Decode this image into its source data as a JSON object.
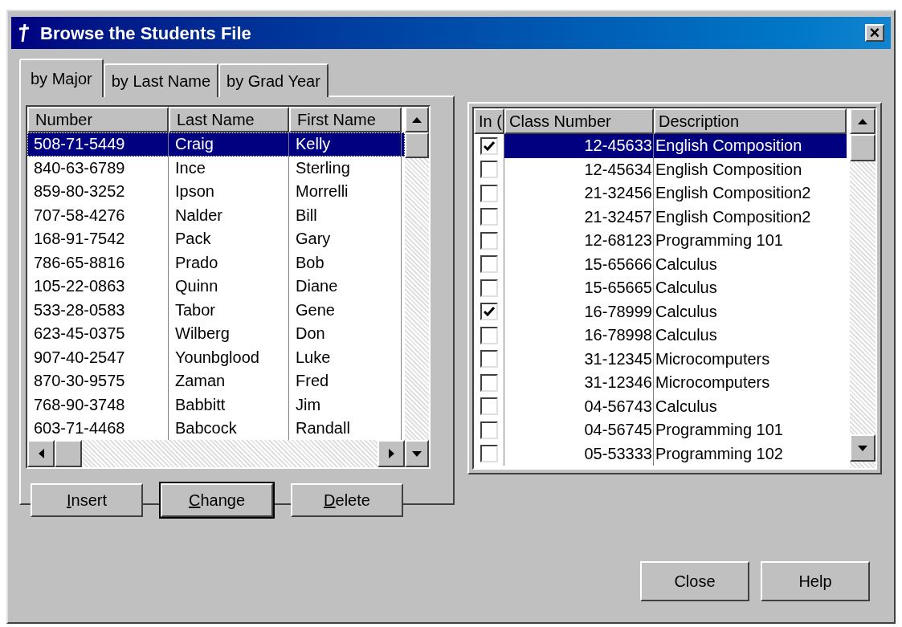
{
  "window": {
    "title": "Browse the Students File",
    "close": "×"
  },
  "tabs": [
    {
      "label": "by Major",
      "selected": true
    },
    {
      "label": "by Last Name",
      "selected": false
    },
    {
      "label": "by Grad Year",
      "selected": false
    }
  ],
  "students": {
    "columns": [
      "Number",
      "Last Name",
      "First Name"
    ],
    "rows": [
      {
        "cells": [
          "508-71-5449",
          "Craig",
          "Kelly"
        ],
        "selected": true
      },
      {
        "cells": [
          "840-63-6789",
          "Ince",
          "Sterling"
        ],
        "selected": false
      },
      {
        "cells": [
          "859-80-3252",
          "Ipson",
          "Morrelli"
        ],
        "selected": false
      },
      {
        "cells": [
          "707-58-4276",
          "Nalder",
          "Bill"
        ],
        "selected": false
      },
      {
        "cells": [
          "168-91-7542",
          "Pack",
          "Gary"
        ],
        "selected": false
      },
      {
        "cells": [
          "786-65-8816",
          "Prado",
          "Bob"
        ],
        "selected": false
      },
      {
        "cells": [
          "105-22-0863",
          "Quinn",
          "Diane"
        ],
        "selected": false
      },
      {
        "cells": [
          "533-28-0583",
          "Tabor",
          "Gene"
        ],
        "selected": false
      },
      {
        "cells": [
          "623-45-0375",
          "Wilberg",
          "Don"
        ],
        "selected": false
      },
      {
        "cells": [
          "907-40-2547",
          "Younbglood",
          "Luke"
        ],
        "selected": false
      },
      {
        "cells": [
          "870-30-9575",
          "Zaman",
          "Fred"
        ],
        "selected": false
      },
      {
        "cells": [
          "768-90-3748",
          "Babbitt",
          "Jim"
        ],
        "selected": false
      },
      {
        "cells": [
          "603-71-4468",
          "Babcock",
          "Randall"
        ],
        "selected": false
      }
    ]
  },
  "student_buttons": [
    {
      "label": "Insert",
      "default": false
    },
    {
      "label": "Change",
      "default": true
    },
    {
      "label": "Delete",
      "default": false
    }
  ],
  "classes": {
    "columns": [
      "In (",
      "Class Number",
      "Description"
    ],
    "rows": [
      {
        "checked": true,
        "class_number": "12-45633",
        "description": "English Composition",
        "selected": true
      },
      {
        "checked": false,
        "class_number": "12-45634",
        "description": "English Composition",
        "selected": false
      },
      {
        "checked": false,
        "class_number": "21-32456",
        "description": "English Composition2",
        "selected": false
      },
      {
        "checked": false,
        "class_number": "21-32457",
        "description": "English Composition2",
        "selected": false
      },
      {
        "checked": false,
        "class_number": "12-68123",
        "description": "Programming 101",
        "selected": false
      },
      {
        "checked": false,
        "class_number": "15-65666",
        "description": "Calculus",
        "selected": false
      },
      {
        "checked": false,
        "class_number": "15-65665",
        "description": "Calculus",
        "selected": false
      },
      {
        "checked": true,
        "class_number": "16-78999",
        "description": "Calculus",
        "selected": false
      },
      {
        "checked": false,
        "class_number": "16-78998",
        "description": "Calculus",
        "selected": false
      },
      {
        "checked": false,
        "class_number": "31-12345",
        "description": "Microcomputers",
        "selected": false
      },
      {
        "checked": false,
        "class_number": "31-12346",
        "description": "Microcomputers",
        "selected": false
      },
      {
        "checked": false,
        "class_number": "04-56743",
        "description": "Calculus",
        "selected": false
      },
      {
        "checked": false,
        "class_number": "04-56745",
        "description": "Programming 101",
        "selected": false
      },
      {
        "checked": false,
        "class_number": "05-53333",
        "description": "Programming 102",
        "selected": false
      }
    ]
  },
  "dialog_buttons": [
    "Close",
    "Help"
  ]
}
